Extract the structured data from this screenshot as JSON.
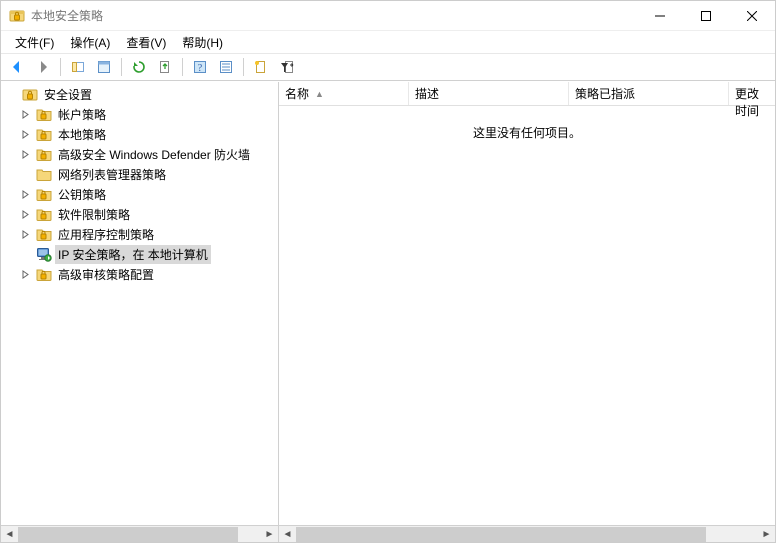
{
  "window": {
    "title": "本地安全策略"
  },
  "menus": {
    "file": "文件(F)",
    "action": "操作(A)",
    "view": "查看(V)",
    "help": "帮助(H)"
  },
  "tree": {
    "root": {
      "label": "安全设置"
    },
    "items": [
      {
        "label": "帐户策略",
        "expandable": true
      },
      {
        "label": "本地策略",
        "expandable": true
      },
      {
        "label": "高级安全 Windows Defender 防火墙",
        "expandable": true
      },
      {
        "label": "网络列表管理器策略",
        "expandable": false
      },
      {
        "label": "公钥策略",
        "expandable": true
      },
      {
        "label": "软件限制策略",
        "expandable": true
      },
      {
        "label": "应用程序控制策略",
        "expandable": true
      },
      {
        "label": "IP 安全策略，在 本地计算机",
        "expandable": false,
        "selected": true,
        "monitor": true
      },
      {
        "label": "高级审核策略配置",
        "expandable": true
      }
    ]
  },
  "columns": {
    "name": "名称",
    "desc": "描述",
    "assigned": "策略已指派",
    "changed": "上次更改时间"
  },
  "list": {
    "empty": "这里没有任何项目。"
  }
}
